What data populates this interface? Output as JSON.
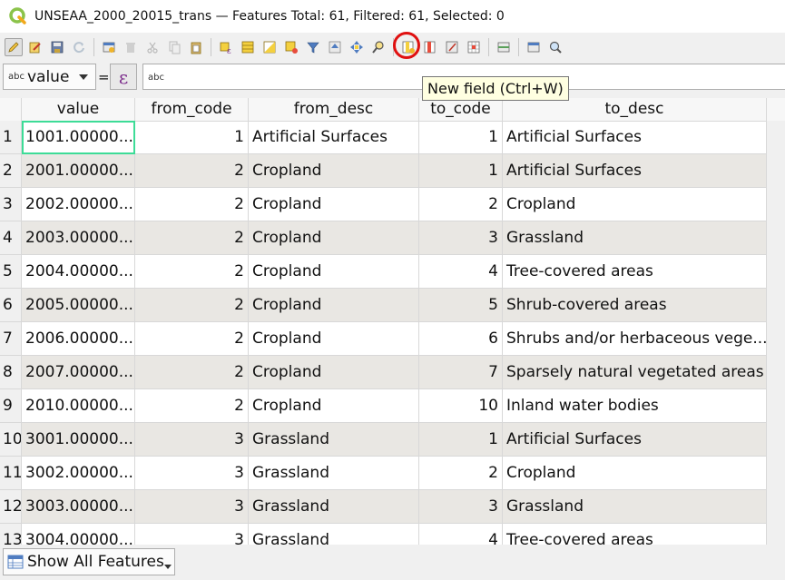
{
  "window": {
    "title": "UNSEAA_2000_20015_trans — Features Total: 61, Filtered: 61, Selected: 0"
  },
  "toolbar": {
    "icons": [
      "pencil-icon",
      "multi-edit-icon",
      "save-icon",
      "reload-icon",
      "add-feature-icon",
      "delete-icon",
      "cut-icon",
      "copy-icon",
      "paste-icon",
      "select-expression-icon",
      "select-all-icon",
      "invert-selection-icon",
      "deselect-icon",
      "filter-icon",
      "move-selection-top-icon",
      "pan-to-selection-icon",
      "zoom-to-selection-icon",
      "new-field-icon",
      "delete-field-icon",
      "field-calculator-icon",
      "conditional-format-icon",
      "dock-icon",
      "actions-icon",
      "zoom-icon"
    ]
  },
  "expression_bar": {
    "field_type": "abc",
    "field_name": "value",
    "equals": "=",
    "epsilon": "ε",
    "input_type": "abc",
    "input_value": ""
  },
  "tooltip": {
    "text": "New field (Ctrl+W)"
  },
  "table": {
    "columns": [
      "value",
      "from_code",
      "from_desc",
      "to_code",
      "to_desc"
    ],
    "rows": [
      {
        "n": "1",
        "value": "1001.00000...",
        "from_code": "1",
        "from_desc": "Artificial Surfaces",
        "to_code": "1",
        "to_desc": "Artificial Surfaces"
      },
      {
        "n": "2",
        "value": "2001.00000...",
        "from_code": "2",
        "from_desc": "Cropland",
        "to_code": "1",
        "to_desc": "Artificial Surfaces"
      },
      {
        "n": "3",
        "value": "2002.00000...",
        "from_code": "2",
        "from_desc": "Cropland",
        "to_code": "2",
        "to_desc": "Cropland"
      },
      {
        "n": "4",
        "value": "2003.00000...",
        "from_code": "2",
        "from_desc": "Cropland",
        "to_code": "3",
        "to_desc": "Grassland"
      },
      {
        "n": "5",
        "value": "2004.00000...",
        "from_code": "2",
        "from_desc": "Cropland",
        "to_code": "4",
        "to_desc": "Tree-covered areas"
      },
      {
        "n": "6",
        "value": "2005.00000...",
        "from_code": "2",
        "from_desc": "Cropland",
        "to_code": "5",
        "to_desc": "Shrub-covered areas"
      },
      {
        "n": "7",
        "value": "2006.00000...",
        "from_code": "2",
        "from_desc": "Cropland",
        "to_code": "6",
        "to_desc": "Shrubs and/or herbaceous vege..."
      },
      {
        "n": "8",
        "value": "2007.00000...",
        "from_code": "2",
        "from_desc": "Cropland",
        "to_code": "7",
        "to_desc": "Sparsely natural vegetated areas"
      },
      {
        "n": "9",
        "value": "2010.00000...",
        "from_code": "2",
        "from_desc": "Cropland",
        "to_code": "10",
        "to_desc": "Inland water bodies"
      },
      {
        "n": "10",
        "value": "3001.00000...",
        "from_code": "3",
        "from_desc": "Grassland",
        "to_code": "1",
        "to_desc": "Artificial Surfaces"
      },
      {
        "n": "11",
        "value": "3002.00000...",
        "from_code": "3",
        "from_desc": "Grassland",
        "to_code": "2",
        "to_desc": "Cropland"
      },
      {
        "n": "12",
        "value": "3003.00000...",
        "from_code": "3",
        "from_desc": "Grassland",
        "to_code": "3",
        "to_desc": "Grassland"
      },
      {
        "n": "13",
        "value": "3004.00000...",
        "from_code": "3",
        "from_desc": "Grassland",
        "to_code": "4",
        "to_desc": "Tree-covered areas"
      }
    ]
  },
  "bottom": {
    "show_all_label": "Show All Features"
  },
  "colors": {
    "selected_cell_outline": "#3ddc97",
    "highlight_ring": "#e01010",
    "alt_row": "#e9e7e3",
    "tooltip_bg": "#ffffe1"
  }
}
